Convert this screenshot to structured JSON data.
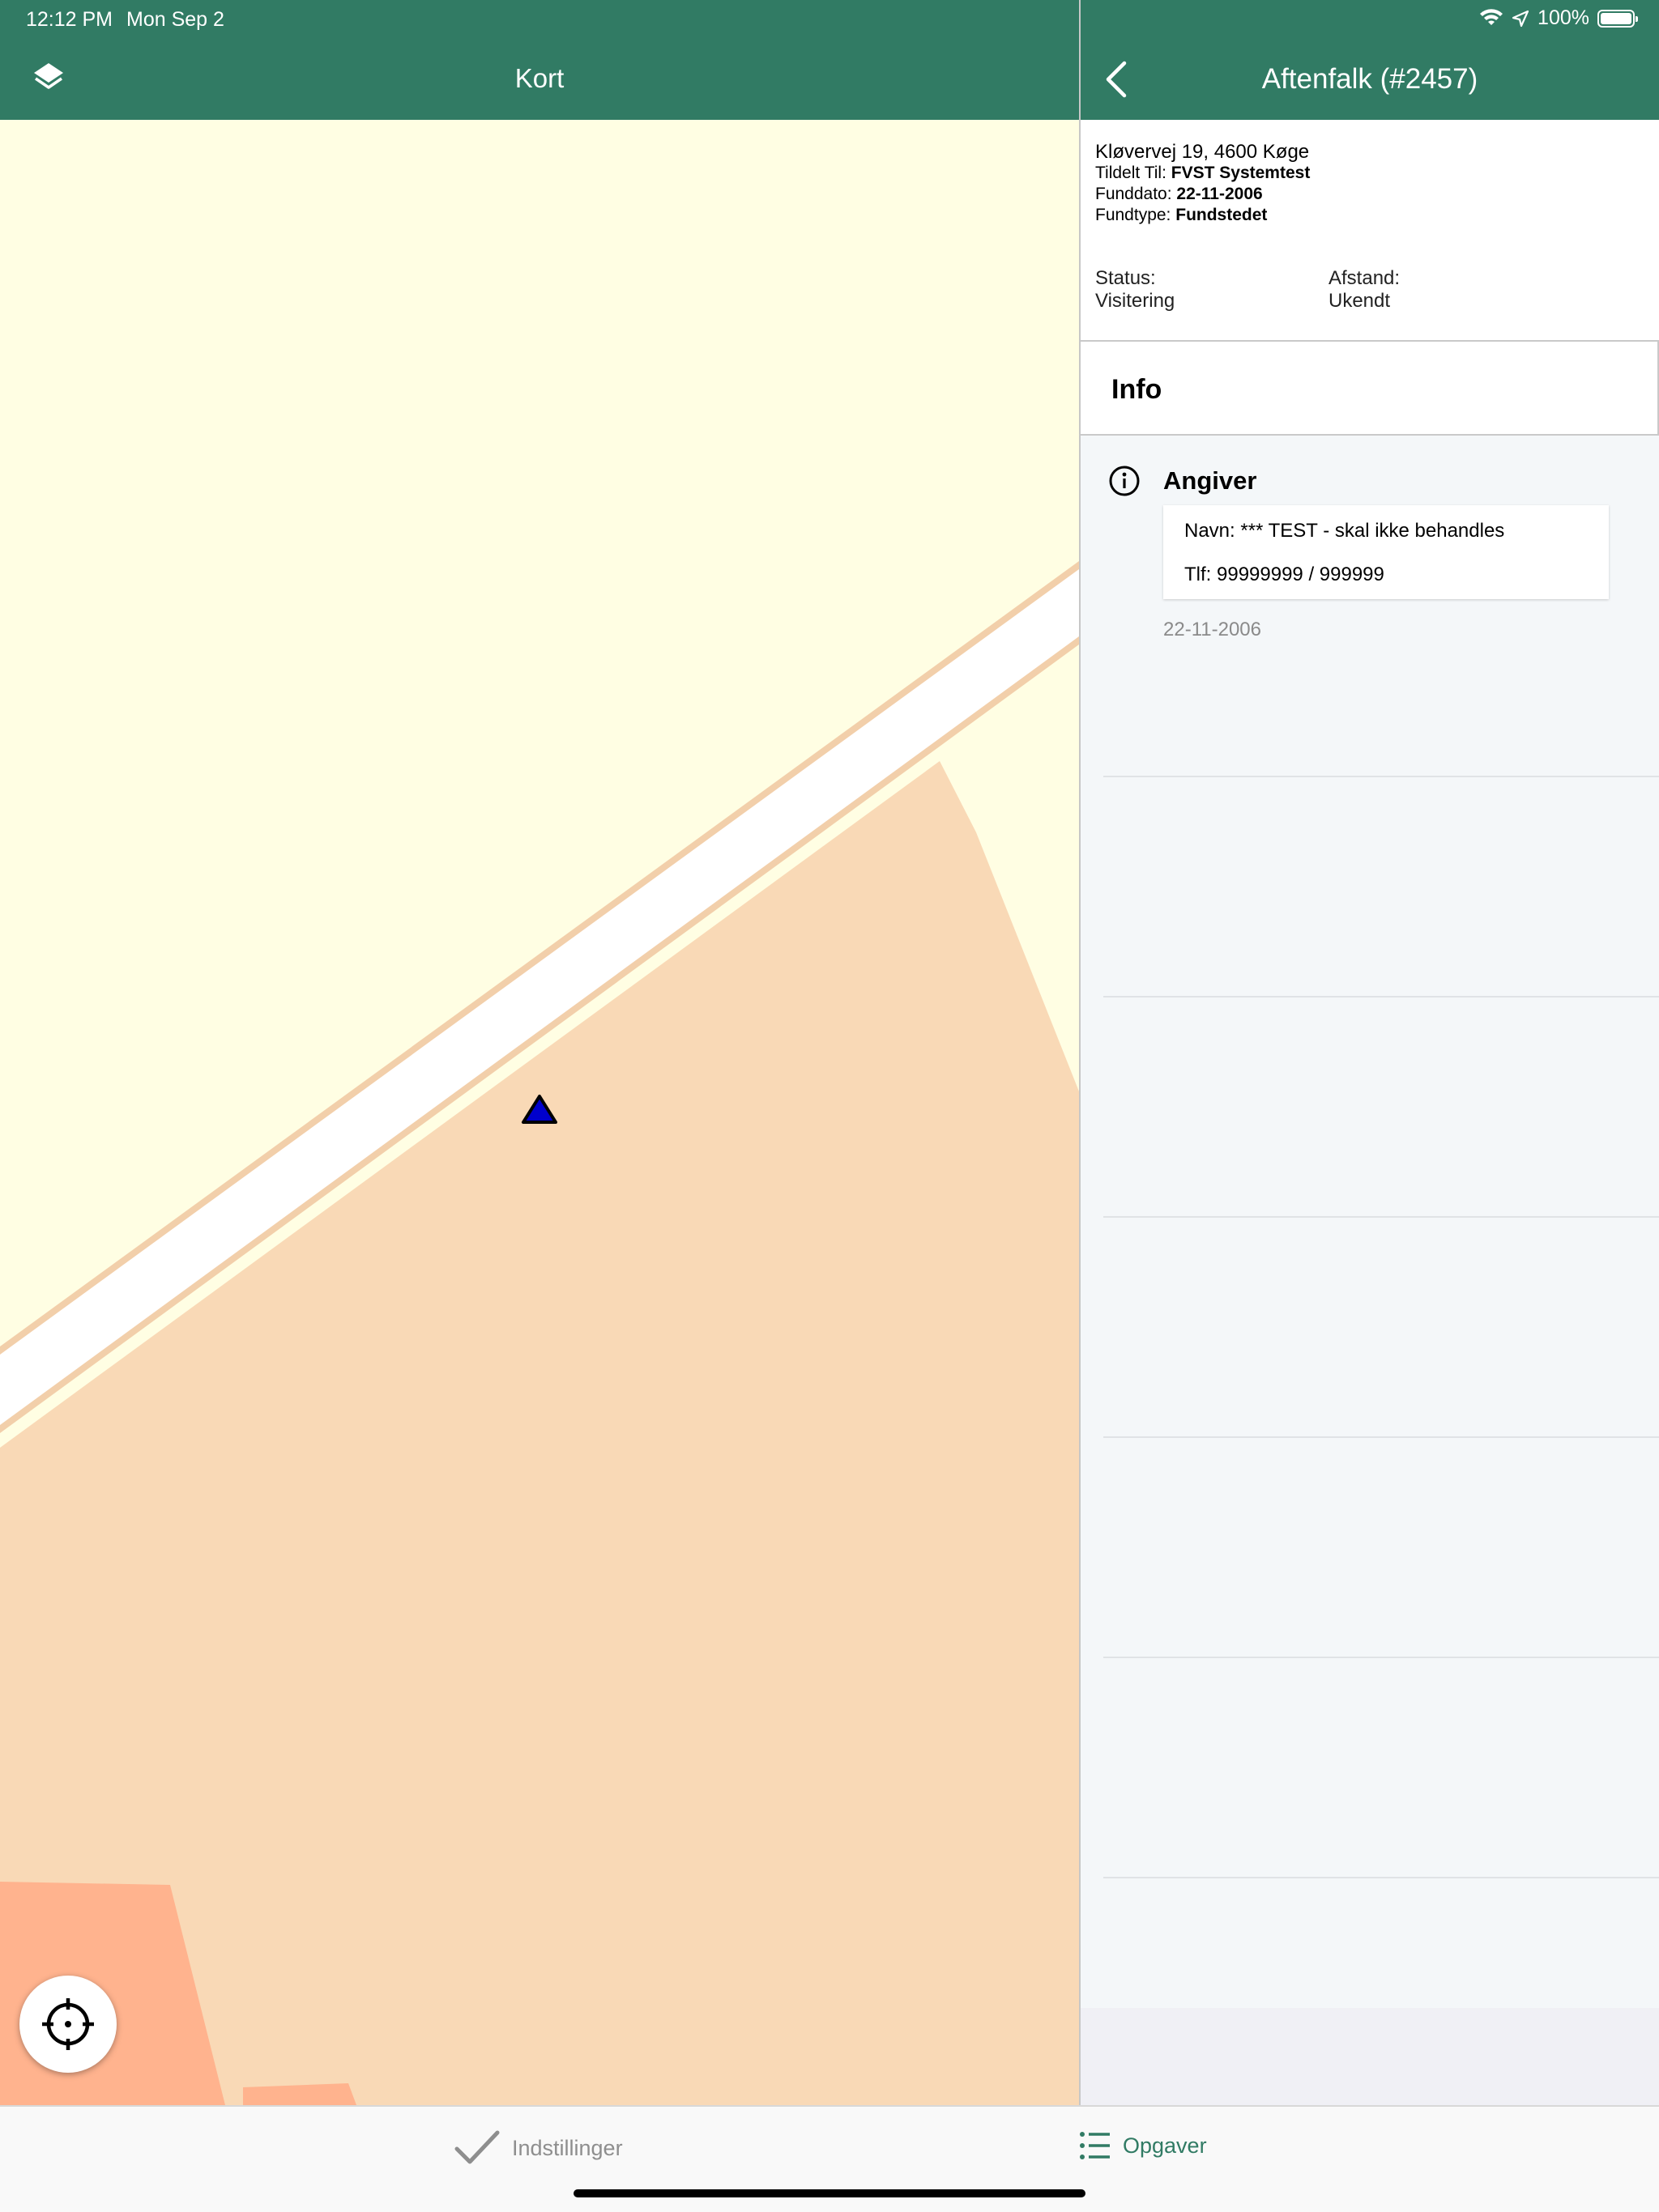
{
  "status_bar": {
    "time": "12:12 PM",
    "date": "Mon Sep 2",
    "battery": "100%"
  },
  "map_panel": {
    "title": "Kort"
  },
  "detail_panel": {
    "title": "Aftenfalk (#2457)",
    "address": "Kløvervej 19, 4600 Køge",
    "tildelt_label": "Tildelt Til:",
    "tildelt_value": "FVST Systemtest",
    "funddato_label": "Funddato:",
    "funddato_value": "22-11-2006",
    "fundtype_label": "Fundtype:",
    "fundtype_value": "Fundstedet",
    "status_label": "Status:",
    "status_value": "Visitering",
    "afstand_label": "Afstand:",
    "afstand_value": "Ukendt",
    "info_tab": "Info",
    "angiver": {
      "title": "Angiver",
      "navn": "Navn: *** TEST - skal ikke behandles",
      "tlf": "Tlf: 99999999 / 999999",
      "date": "22-11-2006"
    }
  },
  "tab_bar": {
    "settings": "Indstillinger",
    "tasks": "Opgaver"
  },
  "colors": {
    "brand": "#317b64",
    "map_land": "#fffee3",
    "map_residential": "#f9d9b6",
    "map_building": "#ffb38e",
    "marker": "#0000cc"
  },
  "icons": {
    "layers": "layers-icon",
    "back": "chevron-left-icon",
    "locate": "crosshair-icon",
    "info": "info-circle-icon",
    "settings": "checkmark-icon",
    "tasks": "list-icon"
  }
}
